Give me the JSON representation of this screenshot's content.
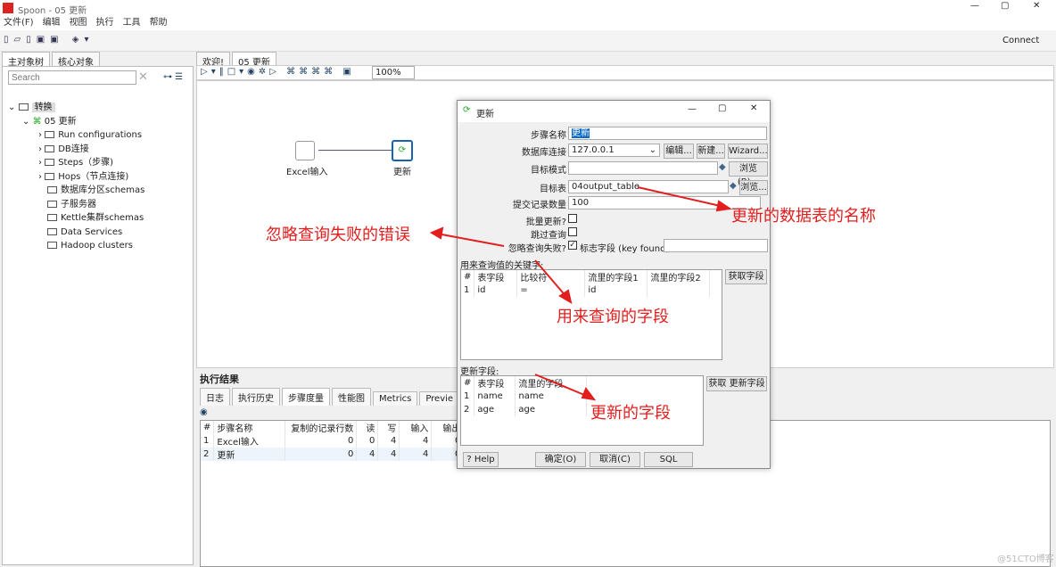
{
  "window": {
    "title": "Spoon - 05 更新",
    "connect": "Connect"
  },
  "menu": [
    "文件(F)",
    "编辑",
    "视图",
    "执行",
    "工具",
    "帮助"
  ],
  "left": {
    "tabs": [
      "主对象树",
      "核心对象"
    ],
    "search_placeholder": "Search",
    "tree": {
      "root": "转换",
      "trans": "05 更新",
      "items": [
        "Run configurations",
        "DB连接",
        "Steps（步骤)",
        "Hops（节点连接)",
        "数据库分区schemas",
        "子服务器",
        "Kettle集群schemas",
        "Data Services",
        "Hadoop clusters"
      ]
    }
  },
  "editor": {
    "tabs": [
      "欢迎!",
      "05 更新"
    ],
    "zoom": "100%",
    "steps": [
      "Excel输入",
      "更新"
    ]
  },
  "results": {
    "title": "执行结果",
    "tabs": [
      "日志",
      "执行历史",
      "步骤度量",
      "性能图",
      "Metrics",
      "Previe"
    ],
    "columns": [
      "#",
      "步骤名称",
      "复制的记录行数",
      "读",
      "写",
      "输入",
      "输出"
    ],
    "rows": [
      [
        "1",
        "Excel输入",
        "0",
        "0",
        "4",
        "4",
        "0"
      ],
      [
        "2",
        "更新",
        "0",
        "4",
        "4",
        "4",
        "0"
      ]
    ]
  },
  "dialog": {
    "title": "更新",
    "step_name_label": "步骤名称",
    "step_name": "更新",
    "db_label": "数据库连接",
    "db": "127.0.0.1",
    "edit": "编辑...",
    "new": "新建...",
    "wizard": "Wizard...",
    "schema_label": "目标模式",
    "schema": "",
    "browse_b": "浏览(B)...",
    "table_label": "目标表",
    "table": "04output_table",
    "browse": "浏览...",
    "commit_label": "提交记录数量",
    "commit": "100",
    "batch_label": "批量更新?",
    "skip_label": "跳过查询",
    "ignore_label": "忽略查询失败?",
    "flag_label": "标志字段 (key found)",
    "flag_value": "",
    "keys_label": "用来查询值的关键字:",
    "keys_columns": [
      "#",
      "表字段",
      "比较符",
      "流里的字段1",
      "流里的字段2"
    ],
    "keys_rows": [
      [
        "1",
        "id",
        "=",
        "id",
        ""
      ]
    ],
    "get_fields": "获取字段",
    "update_label": "更新字段:",
    "update_columns": [
      "#",
      "表字段",
      "流里的字段"
    ],
    "update_rows": [
      [
        "1",
        "name",
        "name"
      ],
      [
        "2",
        "age",
        "age"
      ]
    ],
    "get_update": "获取 更新字段",
    "help": "Help",
    "ok": "确定(O)",
    "cancel": "取消(C)",
    "sql": "SQL"
  },
  "annotations": [
    "更新的数据表的名称",
    "忽略查询失败的错误",
    "用来查询的字段",
    "更新的字段"
  ],
  "watermark": "@51CTO博客",
  "colors": {
    "annotation": "#e31e1e",
    "accent": "#0b6bc6"
  }
}
